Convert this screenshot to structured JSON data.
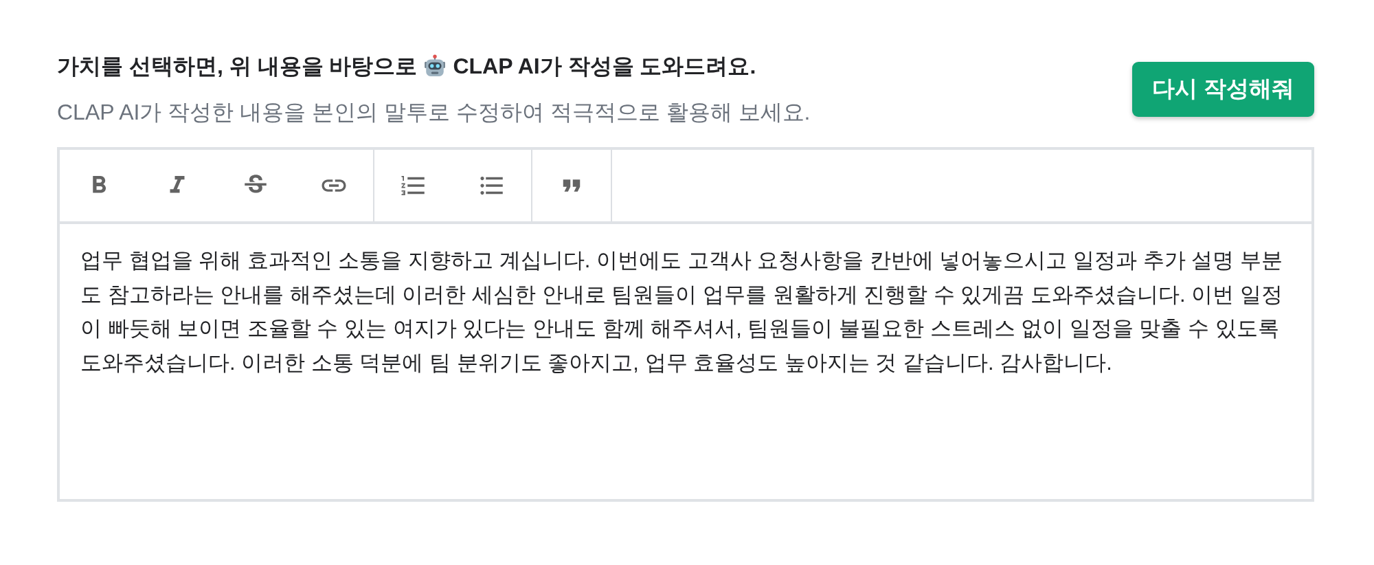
{
  "heading": {
    "text_before_icon": "가치를 선택하면, 위 내용을 바탕으로",
    "text_after_icon": "CLAP AI가 작성을 도와드려요."
  },
  "subheading": "CLAP AI가 작성한 내용을 본인의 말투로 수정하여 적극적으로 활용해 보세요.",
  "rewrite_button": {
    "label": "다시 작성해줘"
  },
  "editor": {
    "value": "업무 협업을 위해 효과적인 소통을 지향하고 계십니다. 이번에도 고객사 요청사항을 칸반에 넣어놓으시고 일정과 추가 설명 부분도 참고하라는 안내를 해주셨는데 이러한 세심한 안내로 팀원들이 업무를 원활하게 진행할 수 있게끔 도와주셨습니다. 이번 일정이 빠듯해 보이면 조율할 수 있는 여지가 있다는 안내도 함께 해주셔서, 팀원들이 불필요한 스트레스 없이 일정을 맞출 수 있도록 도와주셨습니다. 이러한 소통 덕분에 팀 분위기도 좋아지고, 업무 효율성도 높아지는 것 같습니다. 감사합니다."
  }
}
